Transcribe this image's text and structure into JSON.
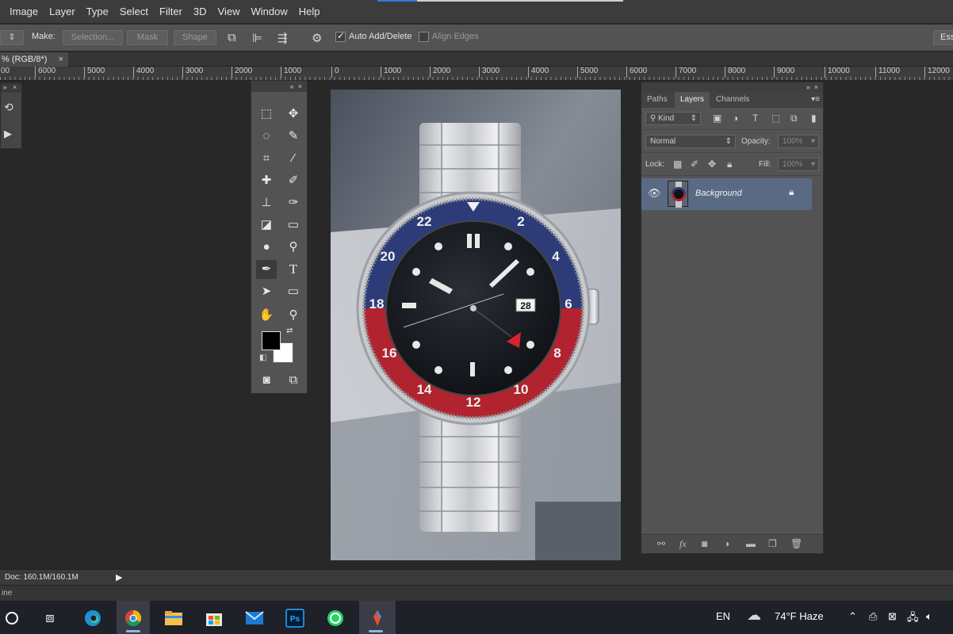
{
  "menu": [
    "Image",
    "Layer",
    "Type",
    "Select",
    "Filter",
    "3D",
    "View",
    "Window",
    "Help"
  ],
  "options": {
    "make_label": "Make:",
    "selection_btn": "Selection...",
    "mask_btn": "Mask",
    "shape_btn": "Shape",
    "auto_add_delete": "Auto Add/Delete",
    "align_edges": "Align Edges",
    "workspace": "Ess"
  },
  "doc_tab": {
    "title": "% (RGB/8*)",
    "close": "×"
  },
  "ruler": [
    "00",
    "6000",
    "5000",
    "4000",
    "3000",
    "2000",
    "1000",
    "0",
    "1000",
    "2000",
    "3000",
    "4000",
    "5000",
    "6000",
    "7000",
    "8000",
    "9000",
    "10000",
    "11000",
    "12000"
  ],
  "layers_panel": {
    "tabs": [
      "Paths",
      "Layers",
      "Channels"
    ],
    "kind": "Kind",
    "blend_mode": "Normal",
    "opacity_label": "Opacity:",
    "opacity_value": "100%",
    "lock_label": "Lock:",
    "fill_label": "Fill:",
    "fill_value": "100%",
    "layer_name": "Background"
  },
  "status": {
    "doc": "Doc: 160.1M/160.1M",
    "timeline": "ine"
  },
  "taskbar": {
    "lang": "EN",
    "weather": "74°F  Haze"
  },
  "watch_bezel": [
    "22",
    "2",
    "4",
    "6",
    "8",
    "10",
    "12",
    "14",
    "16",
    "18",
    "20"
  ],
  "watch_date": "28"
}
